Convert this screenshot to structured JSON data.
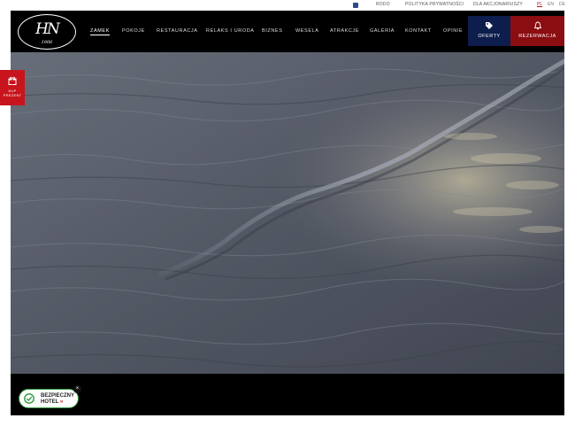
{
  "utility": {
    "facebook_icon": "facebook-icon",
    "links": [
      "RODO",
      "POLITYKA PRYWATNOŚCI",
      "DLA AKCJONARIUSZY"
    ],
    "languages": [
      "PL",
      "EN",
      "DE"
    ],
    "active_language": "PL"
  },
  "logo": {
    "monogram": "HN",
    "year": "1906"
  },
  "nav": {
    "items": [
      "ZAMEK",
      "POKOJE",
      "RESTAURACJA",
      "RELAKS I URODA",
      "BIZNES",
      "WESELA",
      "ATRAKCJE",
      "GALERIA",
      "KONTAKT",
      "OPINIE"
    ],
    "active": "ZAMEK"
  },
  "cta": {
    "offers_label": "OFERTY",
    "offers_icon": "tags-icon",
    "reservation_label": "REZERWACJA",
    "reservation_icon": "bell-icon"
  },
  "gift": {
    "label_line1": "KUP",
    "label_line2": "PREZENT",
    "icon": "gift-icon"
  },
  "badge": {
    "line1": "BEZPIECZNY",
    "line2": "HOTEL",
    "arrow": "»",
    "close": "×"
  },
  "colors": {
    "header_bg": "#000000",
    "offers_bg": "#0d1e4c",
    "reservation_bg": "#8a0d12",
    "gift_bg": "#c8141d",
    "badge_border": "#2e9a3e"
  }
}
